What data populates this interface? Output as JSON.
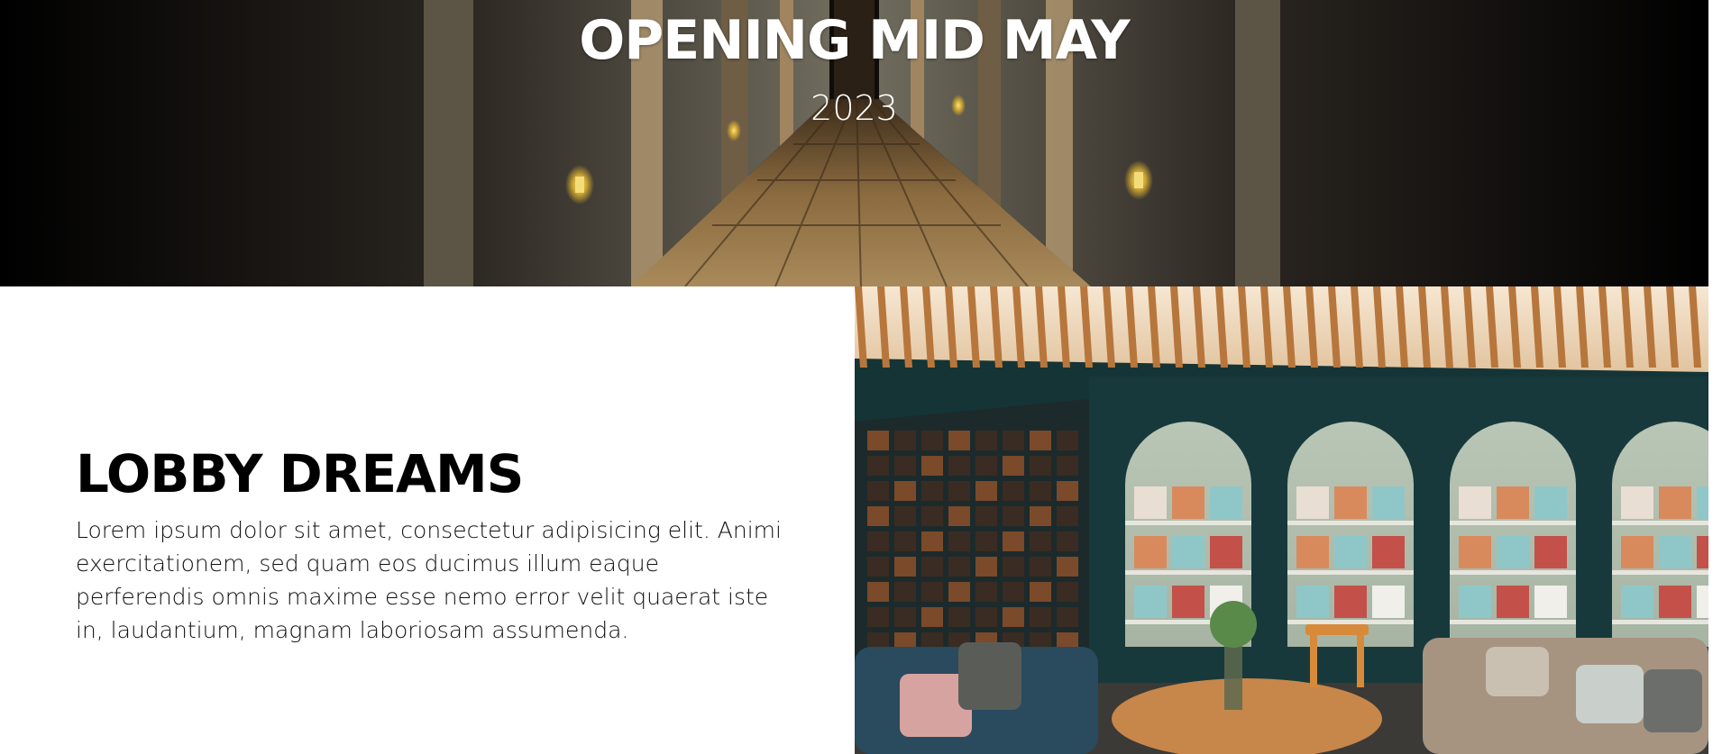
{
  "hero": {
    "title": "OPENING MID MAY",
    "year": "2023",
    "image_icon": "hotel-corridor-image"
  },
  "lobby": {
    "heading": "LOBBY DREAMS",
    "body": "Lorem ipsum dolor sit amet, consectetur adipisicing elit. Animi exercitationem, sed quam eos ducimus illum eaque perferendis omnis maxime esse nemo error velit quaerat iste in, laudantium, magnam laboriosam assumenda.",
    "image_icon": "lobby-lounge-image"
  },
  "scrollbar": {
    "down_icon": "chevron-down-icon"
  },
  "colors": {
    "text_dark": "#000000",
    "text_light": "#ffffff",
    "lobby_wall": "#163a3c",
    "wood": "#c7864a"
  }
}
